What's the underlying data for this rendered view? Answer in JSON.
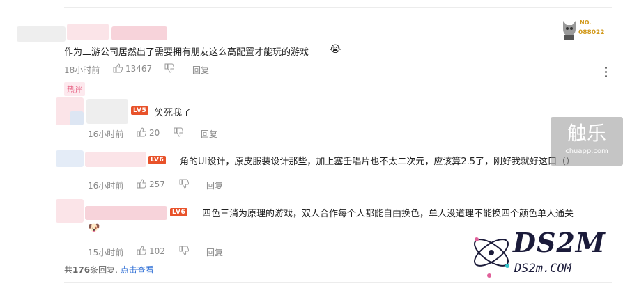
{
  "comments": [
    {
      "text": "作为二游公司居然出了需要拥有朋友这么高配置才能玩的游戏",
      "time": "18小时前",
      "likes": "13467",
      "reply_label": "回复",
      "tag": "热评"
    },
    {
      "level": "LV5",
      "text": "笑死我了",
      "time": "16小时前",
      "likes": "20",
      "reply_label": "回复"
    },
    {
      "level": "LV6",
      "text": "角的UI设计，原皮服装设计那些，加上塞壬唱片也不太二次元，应该算2.5了，刚好我就好这口（）",
      "time": "16小时前",
      "likes": "257",
      "reply_label": "回复"
    },
    {
      "level": "LV6",
      "text": "四色三消为原理的游戏，双人合作每个人都能自由换色，单人没道理不能换四个颜色单人通关",
      "time": "15小时前",
      "likes": "102",
      "reply_label": "回复"
    }
  ],
  "footer": {
    "prefix": "共",
    "count": "176",
    "suffix": "条回复,",
    "link": "点击查看"
  },
  "badge": {
    "no": "NO.",
    "num": "088022"
  },
  "watermarks": {
    "chuapp_big": "触乐",
    "chuapp_small": "chuapp.com",
    "ds2m_big": "DS2M",
    "ds2m_small": "DS2m.COM"
  },
  "colors": {
    "level_badge": "#e8522a",
    "link": "#2f6fd6",
    "hot_tag": "#e86a8a"
  },
  "icons": [
    "thumbs-up-icon",
    "thumbs-down-icon",
    "more-options-icon",
    "emoji-icon"
  ]
}
